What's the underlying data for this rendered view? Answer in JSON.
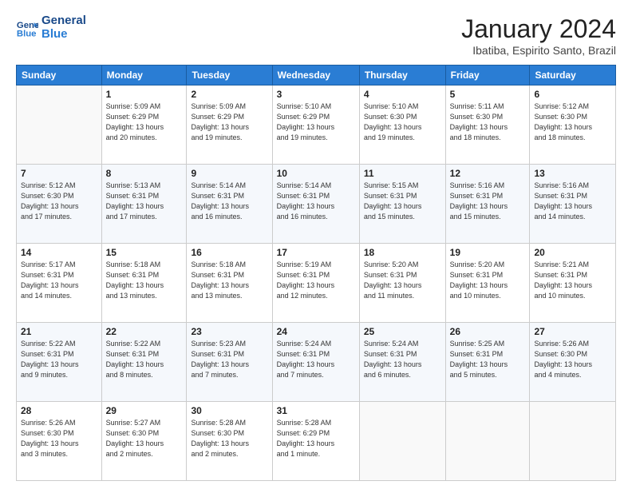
{
  "header": {
    "logo_line1": "General",
    "logo_line2": "Blue",
    "month": "January 2024",
    "location": "Ibatiba, Espirito Santo, Brazil"
  },
  "weekdays": [
    "Sunday",
    "Monday",
    "Tuesday",
    "Wednesday",
    "Thursday",
    "Friday",
    "Saturday"
  ],
  "weeks": [
    [
      {
        "day": "",
        "info": ""
      },
      {
        "day": "1",
        "info": "Sunrise: 5:09 AM\nSunset: 6:29 PM\nDaylight: 13 hours\nand 20 minutes."
      },
      {
        "day": "2",
        "info": "Sunrise: 5:09 AM\nSunset: 6:29 PM\nDaylight: 13 hours\nand 19 minutes."
      },
      {
        "day": "3",
        "info": "Sunrise: 5:10 AM\nSunset: 6:29 PM\nDaylight: 13 hours\nand 19 minutes."
      },
      {
        "day": "4",
        "info": "Sunrise: 5:10 AM\nSunset: 6:30 PM\nDaylight: 13 hours\nand 19 minutes."
      },
      {
        "day": "5",
        "info": "Sunrise: 5:11 AM\nSunset: 6:30 PM\nDaylight: 13 hours\nand 18 minutes."
      },
      {
        "day": "6",
        "info": "Sunrise: 5:12 AM\nSunset: 6:30 PM\nDaylight: 13 hours\nand 18 minutes."
      }
    ],
    [
      {
        "day": "7",
        "info": "Sunrise: 5:12 AM\nSunset: 6:30 PM\nDaylight: 13 hours\nand 17 minutes."
      },
      {
        "day": "8",
        "info": "Sunrise: 5:13 AM\nSunset: 6:31 PM\nDaylight: 13 hours\nand 17 minutes."
      },
      {
        "day": "9",
        "info": "Sunrise: 5:14 AM\nSunset: 6:31 PM\nDaylight: 13 hours\nand 16 minutes."
      },
      {
        "day": "10",
        "info": "Sunrise: 5:14 AM\nSunset: 6:31 PM\nDaylight: 13 hours\nand 16 minutes."
      },
      {
        "day": "11",
        "info": "Sunrise: 5:15 AM\nSunset: 6:31 PM\nDaylight: 13 hours\nand 15 minutes."
      },
      {
        "day": "12",
        "info": "Sunrise: 5:16 AM\nSunset: 6:31 PM\nDaylight: 13 hours\nand 15 minutes."
      },
      {
        "day": "13",
        "info": "Sunrise: 5:16 AM\nSunset: 6:31 PM\nDaylight: 13 hours\nand 14 minutes."
      }
    ],
    [
      {
        "day": "14",
        "info": "Sunrise: 5:17 AM\nSunset: 6:31 PM\nDaylight: 13 hours\nand 14 minutes."
      },
      {
        "day": "15",
        "info": "Sunrise: 5:18 AM\nSunset: 6:31 PM\nDaylight: 13 hours\nand 13 minutes."
      },
      {
        "day": "16",
        "info": "Sunrise: 5:18 AM\nSunset: 6:31 PM\nDaylight: 13 hours\nand 13 minutes."
      },
      {
        "day": "17",
        "info": "Sunrise: 5:19 AM\nSunset: 6:31 PM\nDaylight: 13 hours\nand 12 minutes."
      },
      {
        "day": "18",
        "info": "Sunrise: 5:20 AM\nSunset: 6:31 PM\nDaylight: 13 hours\nand 11 minutes."
      },
      {
        "day": "19",
        "info": "Sunrise: 5:20 AM\nSunset: 6:31 PM\nDaylight: 13 hours\nand 10 minutes."
      },
      {
        "day": "20",
        "info": "Sunrise: 5:21 AM\nSunset: 6:31 PM\nDaylight: 13 hours\nand 10 minutes."
      }
    ],
    [
      {
        "day": "21",
        "info": "Sunrise: 5:22 AM\nSunset: 6:31 PM\nDaylight: 13 hours\nand 9 minutes."
      },
      {
        "day": "22",
        "info": "Sunrise: 5:22 AM\nSunset: 6:31 PM\nDaylight: 13 hours\nand 8 minutes."
      },
      {
        "day": "23",
        "info": "Sunrise: 5:23 AM\nSunset: 6:31 PM\nDaylight: 13 hours\nand 7 minutes."
      },
      {
        "day": "24",
        "info": "Sunrise: 5:24 AM\nSunset: 6:31 PM\nDaylight: 13 hours\nand 7 minutes."
      },
      {
        "day": "25",
        "info": "Sunrise: 5:24 AM\nSunset: 6:31 PM\nDaylight: 13 hours\nand 6 minutes."
      },
      {
        "day": "26",
        "info": "Sunrise: 5:25 AM\nSunset: 6:31 PM\nDaylight: 13 hours\nand 5 minutes."
      },
      {
        "day": "27",
        "info": "Sunrise: 5:26 AM\nSunset: 6:30 PM\nDaylight: 13 hours\nand 4 minutes."
      }
    ],
    [
      {
        "day": "28",
        "info": "Sunrise: 5:26 AM\nSunset: 6:30 PM\nDaylight: 13 hours\nand 3 minutes."
      },
      {
        "day": "29",
        "info": "Sunrise: 5:27 AM\nSunset: 6:30 PM\nDaylight: 13 hours\nand 2 minutes."
      },
      {
        "day": "30",
        "info": "Sunrise: 5:28 AM\nSunset: 6:30 PM\nDaylight: 13 hours\nand 2 minutes."
      },
      {
        "day": "31",
        "info": "Sunrise: 5:28 AM\nSunset: 6:29 PM\nDaylight: 13 hours\nand 1 minute."
      },
      {
        "day": "",
        "info": ""
      },
      {
        "day": "",
        "info": ""
      },
      {
        "day": "",
        "info": ""
      }
    ]
  ]
}
